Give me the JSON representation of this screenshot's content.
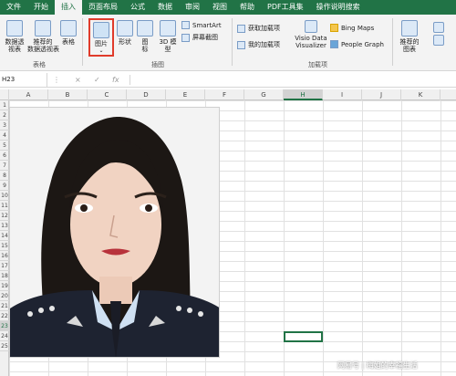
{
  "ribbon_tabs": [
    "文件",
    "开始",
    "插入",
    "页面布局",
    "公式",
    "数据",
    "审阅",
    "视图",
    "帮助",
    "PDF工具集",
    "操作说明搜索"
  ],
  "active_tab": "插入",
  "ribbon": {
    "pivot_table": "数据透\n视表",
    "recommended_pivot": "推荐的\n数据透视表",
    "table": "表格",
    "group_table": "表格",
    "picture": "图片",
    "shapes": "形状",
    "icons": "图\n标",
    "models_3d": "3D 模\n型",
    "smartart": "SmartArt",
    "screenshot": "屏幕截图",
    "group_illustrations": "插图",
    "get_addins": "获取加载项",
    "my_addins": "我的加载项",
    "visio": "Visio Data\nVisualizer",
    "bing_maps": "Bing Maps",
    "people_graph": "People Graph",
    "group_addins": "加载项",
    "recommended_charts": "推荐的\n图表"
  },
  "formula_bar": {
    "name_box": "H23",
    "fx": "fx",
    "cancel": "×",
    "enter": "✓",
    "value": ""
  },
  "columns": [
    "A",
    "B",
    "C",
    "D",
    "E",
    "F",
    "G",
    "H",
    "I",
    "J",
    "K"
  ],
  "selected_column": "H",
  "rows": [
    "1",
    "2",
    "3",
    "4",
    "5",
    "6",
    "7",
    "8",
    "9",
    "10",
    "11",
    "12",
    "13",
    "14",
    "15",
    "16",
    "17",
    "18",
    "19",
    "20",
    "21",
    "22",
    "23",
    "24",
    "25"
  ],
  "selected_row": "23",
  "watermark": "网易号 | 梅姐的幸福生活",
  "colors": {
    "excel_green": "#217346",
    "picture_highlight": "#e03b2b"
  }
}
